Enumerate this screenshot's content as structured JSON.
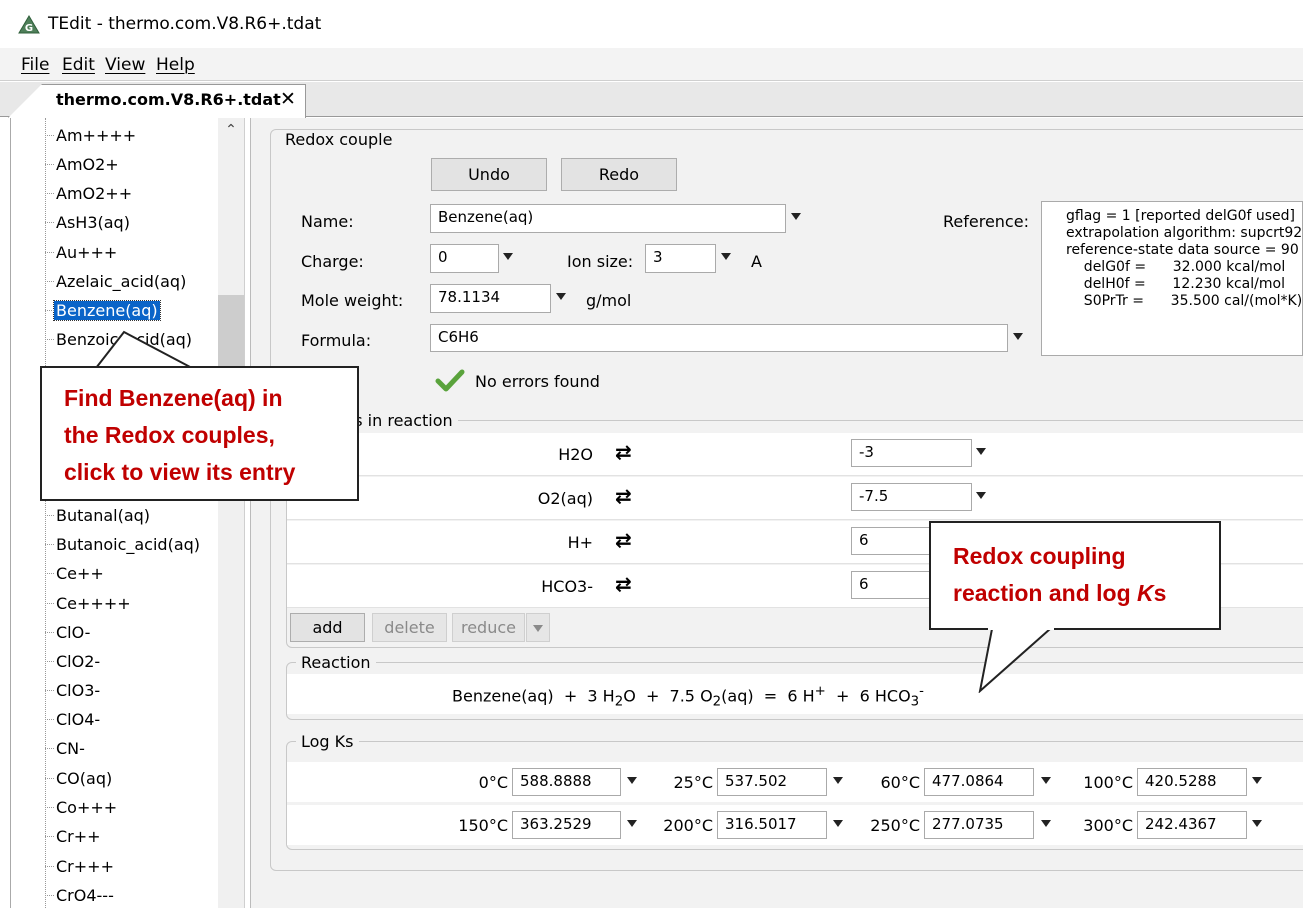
{
  "window": {
    "title": "TEdit - thermo.com.V8.R6+.tdat"
  },
  "menu": [
    "File",
    "Edit",
    "View",
    "Help"
  ],
  "tab": {
    "label": "thermo.com.V8.R6+.tdat",
    "close": "✕"
  },
  "sidebar": {
    "items": [
      "Am++++",
      "AmO2+",
      "AmO2++",
      "AsH3(aq)",
      "Au+++",
      "Azelaic_acid(aq)",
      "Benzene(aq)",
      "Benzoic_acid(aq)",
      "Butanal(aq)",
      "Butanoic_acid(aq)",
      "Ce++",
      "Ce++++",
      "ClO-",
      "ClO2-",
      "ClO3-",
      "ClO4-",
      "CN-",
      "CO(aq)",
      "Co+++",
      "Cr++",
      "Cr+++",
      "CrO4---"
    ],
    "selected": "Benzene(aq)"
  },
  "redox": {
    "legend": "Redox couple",
    "undo": "Undo",
    "redo": "Redo",
    "name_label": "Name:",
    "name_value": "Benzene(aq)",
    "charge_label": "Charge:",
    "charge_value": "0",
    "ion_size_label": "Ion size:",
    "ion_size_value": "3",
    "ion_size_unit": "A",
    "mole_weight_label": "Mole weight:",
    "mole_weight_value": "78.1134",
    "mole_weight_unit": "g/mol",
    "formula_label": "Formula:",
    "formula_value": "C6H6",
    "reference_label": "Reference:",
    "reference_text": "gflag = 1 [reported delG0f used]\nextrapolation algorithm: supcrt92\nreference-state data source = 90\n    delG0f =      32.000 kcal/mol\n    delH0f =      12.230 kcal/mol\n    S0PrTr =      35.500 cal/(mol*K)",
    "status": "No errors found",
    "status_color": "#5aa33c"
  },
  "species": {
    "legend": "Species in reaction",
    "rows": [
      {
        "name": "H2O",
        "coef": "-3"
      },
      {
        "name": "O2(aq)",
        "coef": "-7.5"
      },
      {
        "name": "H+",
        "coef": "6"
      },
      {
        "name": "HCO3-",
        "coef": "6"
      }
    ],
    "add": "add",
    "delete": "delete",
    "reduce": "reduce"
  },
  "reaction": {
    "legend": "Reaction",
    "lhs1": "Benzene(aq)",
    "plus": "+",
    "c_h2o": "3",
    "h2o_h": "H",
    "h2o_sub": "2",
    "h2o_o": "O",
    "c_o2": "7.5",
    "o2_o": "O",
    "o2_sub": "2",
    "o2_aq": "(aq)",
    "eq": "=",
    "c_h": "6",
    "h": "H",
    "h_sup": "+",
    "c_hco3": "6",
    "hco3": "HCO",
    "hco3_sub": "3",
    "hco3_sup": "-"
  },
  "logks": {
    "legend": "Log Ks",
    "values": [
      {
        "temp": "0°C",
        "value": "588.8888"
      },
      {
        "temp": "25°C",
        "value": "537.502"
      },
      {
        "temp": "60°C",
        "value": "477.0864"
      },
      {
        "temp": "100°C",
        "value": "420.5288"
      },
      {
        "temp": "150°C",
        "value": "363.2529"
      },
      {
        "temp": "200°C",
        "value": "316.5017"
      },
      {
        "temp": "250°C",
        "value": "277.0735"
      },
      {
        "temp": "300°C",
        "value": "242.4367"
      }
    ]
  },
  "callouts": {
    "left_line1": "Find Benzene(aq) in",
    "left_line2": "the Redox couples,",
    "left_line3": "click to view its entry",
    "right_line1": "Redox coupling",
    "right_line2_pre": "reaction and log ",
    "right_line2_k": "K",
    "right_line2_s": "s",
    "color": "#c00000"
  }
}
